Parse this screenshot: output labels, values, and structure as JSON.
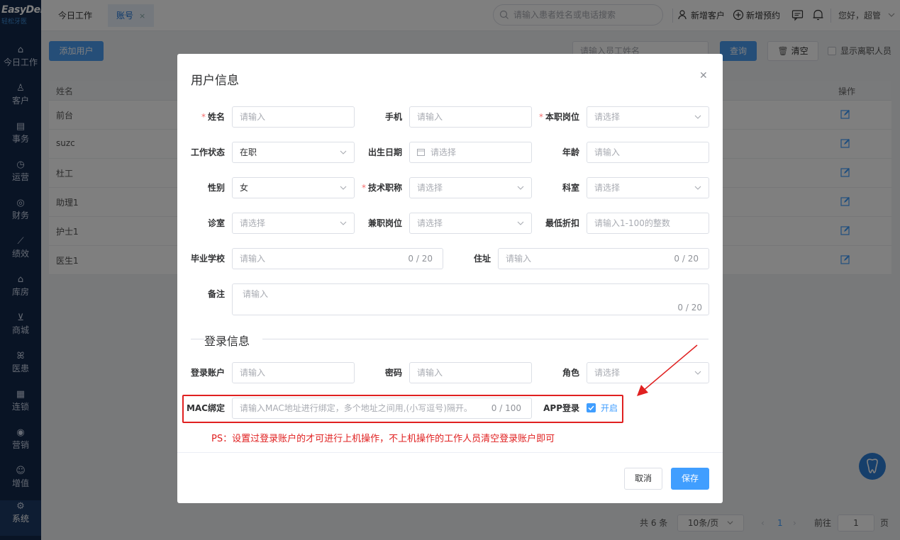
{
  "app": {
    "logo_main": "EasyDent",
    "logo_sub": "轻松牙医"
  },
  "sidebar": {
    "items": [
      {
        "label": "今日工作",
        "icon": "home-icon"
      },
      {
        "label": "客户",
        "icon": "user-icon"
      },
      {
        "label": "事务",
        "icon": "document-icon"
      },
      {
        "label": "运营",
        "icon": "clock-icon"
      },
      {
        "label": "财务",
        "icon": "money-icon"
      },
      {
        "label": "绩效",
        "icon": "chart-line-icon"
      },
      {
        "label": "库房",
        "icon": "warehouse-icon"
      },
      {
        "label": "商城",
        "icon": "cart-icon"
      },
      {
        "label": "医患",
        "icon": "people-icon"
      },
      {
        "label": "连锁",
        "icon": "building-icon"
      },
      {
        "label": "营销",
        "icon": "target-icon"
      },
      {
        "label": "增值",
        "icon": "gift-icon"
      },
      {
        "label": "系统",
        "icon": "gear-icon"
      }
    ],
    "active": "系统"
  },
  "topbar": {
    "tabs": [
      {
        "label": "今日工作"
      },
      {
        "label": "账号",
        "close": "×"
      }
    ],
    "search_placeholder": "请输入患者姓名或电话搜索",
    "new_customer": "新增客户",
    "new_appointment": "新增预约",
    "greeting": "您好，超管"
  },
  "page": {
    "add_user": "添加用户",
    "filter_placeholder": "请输入员工姓名",
    "query": "查询",
    "clear": "清空",
    "show_resigned": "显示离职人员",
    "table": {
      "col_name": "姓名",
      "col_action": "操作",
      "rows": [
        "前台",
        "suzc",
        "杜工",
        "助理1",
        "护士1",
        "医生1"
      ]
    },
    "pagination": {
      "total": "共 6 条",
      "page_size": "10条/页",
      "current": "1",
      "goto_label": "前往",
      "goto_value": "1",
      "page_unit": "页"
    }
  },
  "dialog": {
    "title": "用户信息",
    "fields": {
      "name": {
        "label": "姓名",
        "placeholder": "请输入"
      },
      "phone": {
        "label": "手机",
        "placeholder": "请输入"
      },
      "position": {
        "label": "本职岗位",
        "placeholder": "请选择"
      },
      "work_status": {
        "label": "工作状态",
        "value": "在职"
      },
      "birth_date": {
        "label": "出生日期",
        "placeholder": "请选择"
      },
      "age": {
        "label": "年龄",
        "placeholder": "请输入"
      },
      "gender": {
        "label": "性别",
        "value": "女"
      },
      "tech_title": {
        "label": "技术职称",
        "placeholder": "请选择"
      },
      "department": {
        "label": "科室",
        "placeholder": "请选择"
      },
      "clinic_room": {
        "label": "诊室",
        "placeholder": "请选择"
      },
      "part_time": {
        "label": "兼职岗位",
        "placeholder": "请选择"
      },
      "min_discount": {
        "label": "最低折扣",
        "placeholder": "请输入1-100的整数"
      },
      "school": {
        "label": "毕业学校",
        "placeholder": "请输入",
        "count": "0 / 20"
      },
      "address": {
        "label": "住址",
        "placeholder": "请输入",
        "count": "0 / 20"
      },
      "remark": {
        "label": "备注",
        "placeholder": "请输入",
        "count": "0 / 20"
      }
    },
    "login_section": "登录信息",
    "login": {
      "account": {
        "label": "登录账户",
        "placeholder": "请输入"
      },
      "password": {
        "label": "密码",
        "placeholder": "请输入"
      },
      "role": {
        "label": "角色",
        "placeholder": "请选择"
      },
      "mac": {
        "label": "MAC绑定",
        "placeholder": "请输入MAC地址进行绑定，多个地址之间用,(小写逗号)隔开。",
        "count": "0 / 100"
      },
      "app_login": {
        "label": "APP登录",
        "option": "开启",
        "checked": true
      }
    },
    "note": "PS：设置过登录账户的才可进行上机操作，不上机操作的工作人员清空登录账户即可",
    "cancel": "取消",
    "save": "保存"
  },
  "colors": {
    "sidebar_bg": "#13294b",
    "primary": "#409eff",
    "highlight_red": "#e02020"
  }
}
